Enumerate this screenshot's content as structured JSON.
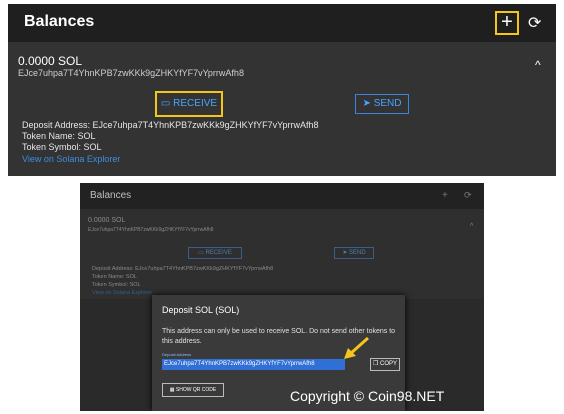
{
  "top": {
    "title": "Balances",
    "add_icon": "+",
    "refresh_icon": "⟳",
    "balance": "0.0000 SOL",
    "address": "EJce7uhpa7T4YhnKPB7zwKKk9gZHKYfYF7vYprrwAfh8",
    "chevron": "^",
    "receive_label": "RECEIVE",
    "send_label": "SEND",
    "deposit_address": "Deposit Address: EJce7uhpa7T4YhnKPB7zwKKk9gZHKYfYF7vYprrwAfh8",
    "token_name": "Token Name: SOL",
    "token_symbol": "Token Symbol: SOL",
    "explorer_link": "View on Solana Explorer",
    "accent_color": "#f5c518"
  },
  "bottom": {
    "title": "Balances",
    "balance": "0.0000 SOL",
    "address": "EJce7uhpa7T4YhnKPB7zwKKk9gZHKYfYF7vYprrwAfh8",
    "receive_label": "RECEIVE",
    "send_label": "SEND",
    "deposit_address": "Deposit Address: EJce7uhpa7T4YhnKPB7zwKKk9gZHKYfYF7vYprrwAfh8",
    "token_name": "Token Name: SOL",
    "token_symbol": "Token Symbol: SOL",
    "explorer_link": "View on Solana Explorer",
    "dialog": {
      "title": "Deposit SOL (SOL)",
      "message": "This address can only be used to receive SOL. Do not send other tokens to this address.",
      "field_label": "Deposit Address",
      "field_value": "EJce7uhpa7T4YhnKPB7zwKKk9gZHKYfYF7vYprrwAfh8",
      "copy_label": "COPY",
      "qr_label": "SHOW QR CODE"
    },
    "copyright": "Copyright © Coin98.NET"
  }
}
